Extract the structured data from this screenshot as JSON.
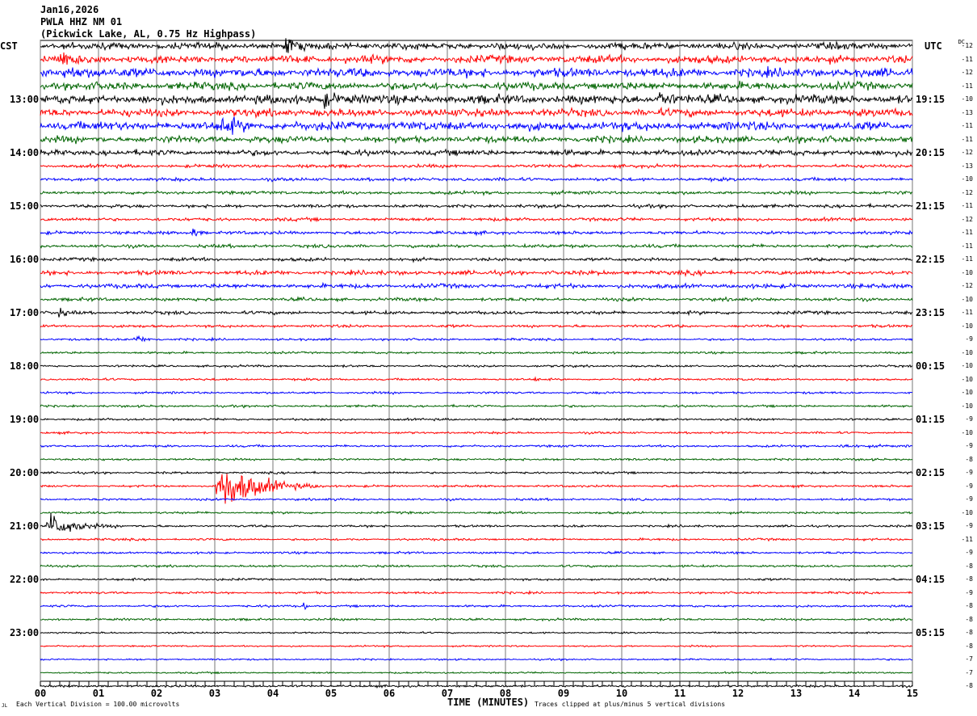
{
  "header": {
    "date": "Jan16,2026",
    "station": "PWLA HHZ NM 01",
    "location": "(Pickwick Lake, AL, 0.75 Hz Highpass)"
  },
  "left_tz": "CST",
  "right_tz": "UTC",
  "dc_label": "DC",
  "footer": {
    "scale": "Each Vertical Division =  100.00 microvolts",
    "xlabel": "TIME (MINUTES)",
    "clip_note": "Traces clipped at plus/minus 5 vertical divisions",
    "corner_mark": "JL"
  },
  "chart_data": {
    "type": "line",
    "title": "PWLA HHZ NM 01 helicorder",
    "xlabel": "TIME (MINUTES)",
    "xlim": [
      0,
      15
    ],
    "x_ticks": [
      "00",
      "01",
      "02",
      "03",
      "04",
      "05",
      "06",
      "07",
      "08",
      "09",
      "10",
      "11",
      "12",
      "13",
      "14",
      "15"
    ],
    "left_hour_labels": [
      "13:00",
      "14:00",
      "15:00",
      "16:00",
      "17:00",
      "18:00",
      "19:00",
      "20:00",
      "21:00",
      "22:00",
      "23:00"
    ],
    "right_hour_labels": [
      "19:15",
      "20:15",
      "21:15",
      "22:15",
      "23:15",
      "00:15",
      "01:15",
      "02:15",
      "03:15",
      "04:15",
      "05:15"
    ],
    "trace_colors": [
      "#000000",
      "#ff0000",
      "#0000ff",
      "#006400"
    ],
    "dc_offsets": [
      -12,
      -11,
      -12,
      -11,
      -10,
      -13,
      -11,
      -11,
      -12,
      -13,
      -10,
      -12,
      -11,
      -12,
      -11,
      -11,
      -11,
      -10,
      -12,
      -10,
      -11,
      -10,
      -9,
      -10,
      -10,
      -10,
      -10,
      -10,
      -9,
      -10,
      -9,
      -8,
      -9,
      -9,
      -9,
      -10,
      -9,
      -11,
      -9,
      -8,
      -8,
      -9,
      -8,
      -8,
      -8,
      -8,
      -7,
      -7,
      -8
    ],
    "noise_amplitude": [
      6,
      7,
      8,
      7,
      8,
      7,
      8,
      6,
      5,
      3,
      3,
      3,
      3,
      3,
      3,
      3,
      3,
      4,
      4,
      3,
      3,
      2.5,
      2,
      2,
      2,
      2,
      2,
      2,
      2,
      2,
      2,
      2,
      2,
      2,
      2,
      2,
      2,
      2,
      2,
      2,
      2,
      2,
      2,
      2,
      1.5,
      1.5,
      1.5,
      1.5
    ],
    "events": [
      {
        "row": 33,
        "start_min": 3.0,
        "duration_min": 1.9,
        "amplitude": 60
      },
      {
        "row": 36,
        "start_min": 0.1,
        "duration_min": 1.3,
        "amplitude": 30
      },
      {
        "row": 1,
        "start_min": 0.3,
        "duration_min": 1.0,
        "amplitude": 12
      },
      {
        "row": 2,
        "start_min": 0.4,
        "duration_min": 1.0,
        "amplitude": 14
      },
      {
        "row": 4,
        "start_min": 4.8,
        "duration_min": 0.9,
        "amplitude": 16
      },
      {
        "row": 4,
        "start_min": 10.6,
        "duration_min": 0.6,
        "amplitude": 18
      },
      {
        "row": 6,
        "start_min": 3.1,
        "duration_min": 0.8,
        "amplitude": 18
      },
      {
        "row": 0,
        "start_min": 4.2,
        "duration_min": 0.4,
        "amplitude": 20
      },
      {
        "row": 14,
        "start_min": 2.6,
        "duration_min": 0.3,
        "amplitude": 12
      },
      {
        "row": 22,
        "start_min": 1.6,
        "duration_min": 0.6,
        "amplitude": 10
      },
      {
        "row": 20,
        "start_min": 0.3,
        "duration_min": 0.4,
        "amplitude": 8
      },
      {
        "row": 25,
        "start_min": 8.5,
        "duration_min": 0.1,
        "amplitude": 12
      },
      {
        "row": 42,
        "start_min": 4.5,
        "duration_min": 0.15,
        "amplitude": 18
      },
      {
        "row": 30,
        "start_min": 13.7,
        "duration_min": 1.0,
        "amplitude": 5
      }
    ]
  }
}
